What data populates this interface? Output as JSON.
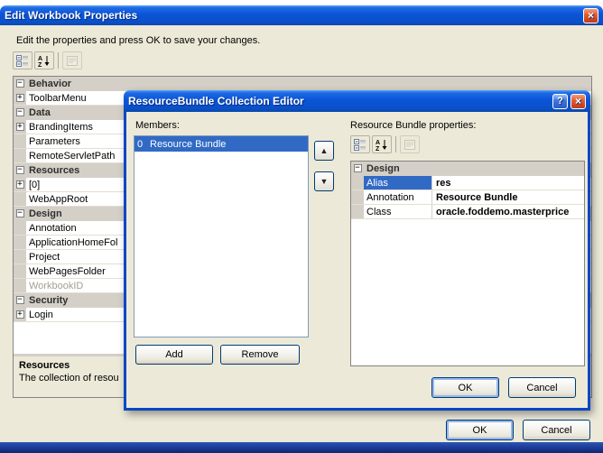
{
  "colors": {
    "selection_blue": "#316AC5",
    "titlebar_blue": "#0A54D8",
    "dialog_face": "#ECE9D8",
    "category_gray": "#D4D0C8",
    "close_button_red": "#D8502E"
  },
  "icons": {
    "close": "×",
    "help": "?",
    "up_arrow": "▲",
    "down_arrow": "▼"
  },
  "outer": {
    "title": "Edit Workbook Properties",
    "instructions": "Edit the properties and press OK to save your changes.",
    "grid_rows": [
      {
        "kind": "category",
        "exp": "-",
        "label": "Behavior"
      },
      {
        "kind": "item",
        "exp": "+",
        "label": "ToolbarMenu"
      },
      {
        "kind": "category",
        "exp": "-",
        "label": "Data"
      },
      {
        "kind": "item",
        "exp": "+",
        "label": "BrandingItems"
      },
      {
        "kind": "item",
        "label": "Parameters"
      },
      {
        "kind": "item",
        "label": "RemoteServletPath"
      },
      {
        "kind": "category",
        "exp": "-",
        "label": "Resources"
      },
      {
        "kind": "item",
        "exp": "+",
        "label": "[0]"
      },
      {
        "kind": "item",
        "label": "WebAppRoot"
      },
      {
        "kind": "category",
        "exp": "-",
        "label": "Design"
      },
      {
        "kind": "item",
        "label": "Annotation"
      },
      {
        "kind": "item",
        "label": "ApplicationHomeFol"
      },
      {
        "kind": "item",
        "label": "Project"
      },
      {
        "kind": "item",
        "label": "WebPagesFolder"
      },
      {
        "kind": "item",
        "label": "WorkbookID",
        "disabled": true
      },
      {
        "kind": "category",
        "exp": "-",
        "label": "Security"
      },
      {
        "kind": "item",
        "exp": "+",
        "label": "Login"
      }
    ],
    "help_title": "Resources",
    "help_text": "The collection of resou",
    "ok_label": "OK",
    "cancel_label": "Cancel"
  },
  "inner": {
    "title": "ResourceBundle Collection Editor",
    "members_label": "Members:",
    "members": [
      {
        "index": "0",
        "label": "Resource Bundle",
        "selected": true
      }
    ],
    "add_label": "Add",
    "remove_label": "Remove",
    "properties_label": "Resource Bundle properties:",
    "grid_rows": [
      {
        "kind": "category",
        "exp": "-",
        "label": "Design"
      },
      {
        "kind": "prop",
        "name": "Alias",
        "value": "res",
        "selected": true
      },
      {
        "kind": "prop",
        "name": "Annotation",
        "value": "Resource Bundle"
      },
      {
        "kind": "prop",
        "name": "Class",
        "value": "oracle.foddemo.masterprice"
      }
    ],
    "ok_label": "OK",
    "cancel_label": "Cancel"
  }
}
